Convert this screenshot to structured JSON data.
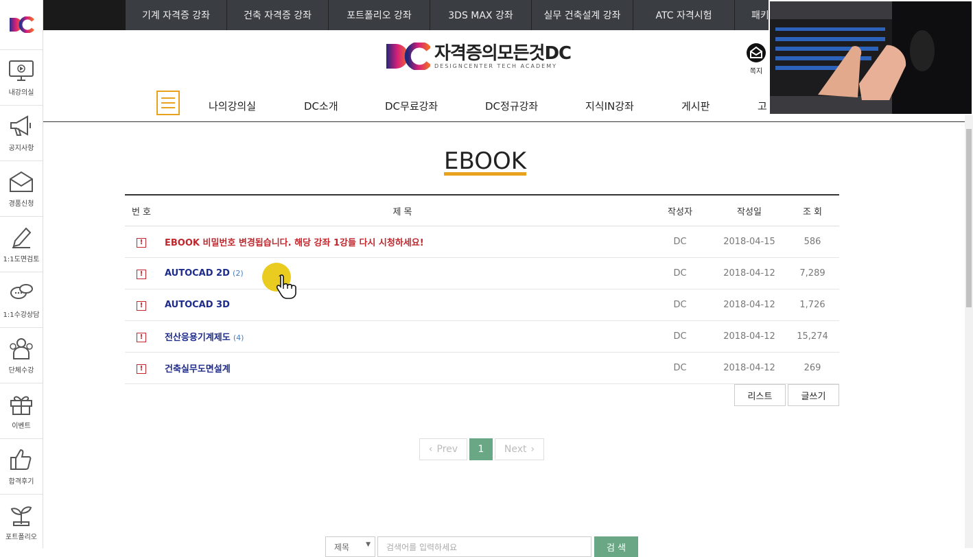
{
  "top_nav": {
    "tabs": [
      "기계 자격증 강좌",
      "건축 자격증 강좌",
      "포트폴리오 강좌",
      "3DS MAX 강좌",
      "실무 건축설계 강좌",
      "ATC 자격시험",
      "패키"
    ]
  },
  "sidebar": {
    "logo": "DC",
    "items": [
      {
        "label": "내강의실",
        "icon": "monitor-icon"
      },
      {
        "label": "공지사항",
        "icon": "megaphone-icon"
      },
      {
        "label": "경품신청",
        "icon": "envelope-icon"
      },
      {
        "label": "1:1도면검토",
        "icon": "pencil-icon"
      },
      {
        "label": "1:1수강상담",
        "icon": "chat-bubbles-icon"
      },
      {
        "label": "단체수강",
        "icon": "group-icon"
      },
      {
        "label": "이벤트",
        "icon": "gift-icon"
      },
      {
        "label": "합격후기",
        "icon": "thumbs-up-icon"
      },
      {
        "label": "포트폴리오",
        "icon": "sprout-icon"
      }
    ]
  },
  "header": {
    "brand_mark": "DC",
    "brand_title": "자격증의모든것DC",
    "brand_subtitle": "DESIGNCENTER TECH ACADEMY",
    "message_label": "쪽지",
    "gnb": [
      "나의강의실",
      "DC소개",
      "DC무료강좌",
      "DC정규강좌",
      "지식IN강좌",
      "게시판",
      "고"
    ]
  },
  "board": {
    "heading": "EBOOK",
    "columns": [
      "번 호",
      "제 목",
      "작성자",
      "작성일",
      "조 회"
    ],
    "rows": [
      {
        "no_icon": "!",
        "title": "EBOOK 비밀번호 변경됩습니다. 해당 강좌 1강들 다시 시청하세요!",
        "comments": "",
        "writer": "DC",
        "date": "2018-04-15",
        "hits": "586",
        "style": "red"
      },
      {
        "no_icon": "!",
        "title": "AUTOCAD 2D",
        "comments": "(2)",
        "writer": "DC",
        "date": "2018-04-12",
        "hits": "7,289",
        "style": "blue"
      },
      {
        "no_icon": "!",
        "title": "AUTOCAD 3D",
        "comments": "",
        "writer": "DC",
        "date": "2018-04-12",
        "hits": "1,726",
        "style": "blue"
      },
      {
        "no_icon": "!",
        "title": "전산응용기계제도",
        "comments": "(4)",
        "writer": "DC",
        "date": "2018-04-12",
        "hits": "15,274",
        "style": "blue"
      },
      {
        "no_icon": "!",
        "title": "건축실무도면설계",
        "comments": "",
        "writer": "DC",
        "date": "2018-04-12",
        "hits": "269",
        "style": "blue"
      }
    ],
    "list_button": "리스트",
    "write_button": "글쓰기"
  },
  "pagination": {
    "prev": "Prev",
    "current": "1",
    "next": "Next"
  },
  "search": {
    "field_option": "제목",
    "placeholder": "검색어를 입력하세요",
    "button": "검 색"
  },
  "colors": {
    "accent": "#e8a21d",
    "notice_red": "#c0272d",
    "title_blue": "#1d2b8c",
    "pager_green": "#6aa785",
    "topbar_tab": "#3a3d42"
  }
}
